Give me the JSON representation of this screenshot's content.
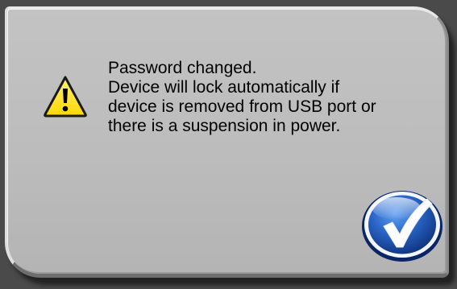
{
  "dialog": {
    "message_lines": [
      "Password changed.",
      "Device will lock automatically if",
      "device is removed from USB port or",
      "there is a suspension in power."
    ],
    "icon": "warning-icon",
    "confirm_icon": "checkmark-icon"
  },
  "colors": {
    "dialog_bg": "#bcbcbc",
    "warning_yellow": "#ffe800",
    "confirm_blue": "#1b4fa8"
  }
}
